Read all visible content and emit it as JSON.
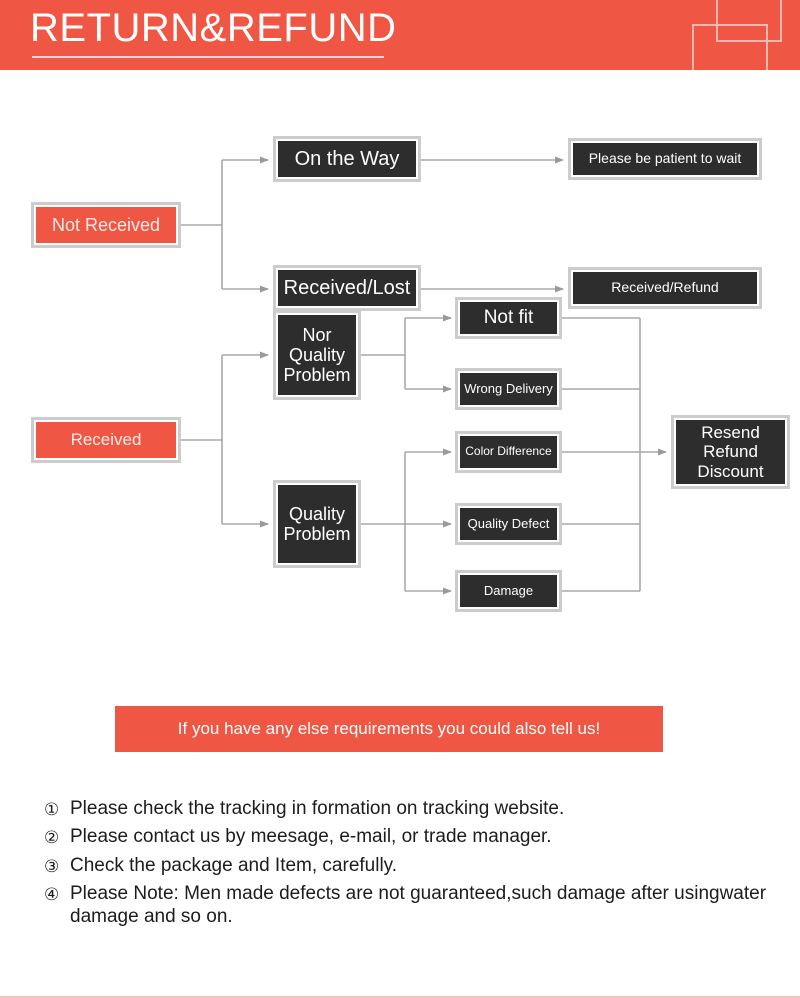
{
  "header": {
    "title": "RETURN&REFUND",
    "accent_color": "#ef5644",
    "title_color": "#ffffff"
  },
  "colors": {
    "accent": "#ef5644",
    "node_fill": "#2d2d2d",
    "node_border": "#cccccc",
    "connector": "#a8a8a8",
    "text_light": "#ffffff"
  },
  "flow_not_received": {
    "root": "Not Received",
    "branches": [
      {
        "stage": "On the Way",
        "outcome": "Please be patient to wait"
      },
      {
        "stage": "Received/Lost",
        "outcome": "Received/Refund"
      }
    ]
  },
  "flow_received": {
    "root": "Received",
    "categories": [
      {
        "label": "Nor\nQuality\nProblem",
        "reasons": [
          "Not fit",
          "Wrong Delivery"
        ]
      },
      {
        "label": "Quality\nProblem",
        "reasons": [
          "Color Difference",
          "Quality Defect",
          "Damage"
        ]
      }
    ],
    "reasons": [
      "Not fit",
      "Wrong Delivery",
      "Color Difference",
      "Quality Defect",
      "Damage"
    ],
    "resolution": "Resend\nRefund\nDiscount"
  },
  "callout": {
    "text": "If you have any else requirements you could also tell us!"
  },
  "notes": [
    {
      "num": "①",
      "text": "Please check the tracking in formation on tracking website."
    },
    {
      "num": "②",
      "text": "Please contact us by meesage, e-mail, or trade manager."
    },
    {
      "num": "③",
      "text": "Check the package and Item, carefully."
    },
    {
      "num": "④",
      "text": "Please Note: Men made defects are not guaranteed,such damage after usingwater damage and so on."
    }
  ]
}
